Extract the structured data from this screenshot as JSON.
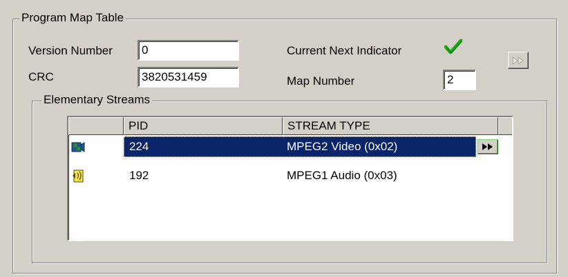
{
  "pmt": {
    "title": "Program Map Table",
    "version_label": "Version Number",
    "version_value": "0",
    "crc_label": "CRC",
    "crc_value": "3820531459",
    "current_next_label": "Current Next Indicator",
    "current_next_checked": true,
    "map_number_label": "Map Number",
    "map_number_value": "2",
    "nav_button_icon": "fast-forward-icon"
  },
  "streams": {
    "title": "Elementary Streams",
    "columns": [
      "PID",
      "STREAM TYPE"
    ],
    "rows": [
      {
        "pid": "224",
        "stream_type": "MPEG2 Video (0x02)",
        "icon": "video-stream-icon",
        "selected": true
      },
      {
        "pid": "192",
        "stream_type": "MPEG1 Audio (0x03)",
        "icon": "audio-stream-icon",
        "selected": false
      }
    ]
  },
  "colors": {
    "window_bg": "#d4d0c8",
    "selection_bg": "#0a246a",
    "check_green": "#1fa81f"
  }
}
